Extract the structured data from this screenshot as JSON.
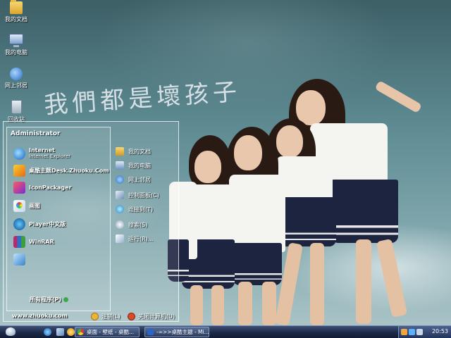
{
  "desktop": {
    "wallpaper_text": "我們都是壞孩子",
    "icons": [
      {
        "label": "我的文档",
        "icon": "folder-icon"
      },
      {
        "label": "我的电脑",
        "icon": "computer-icon"
      },
      {
        "label": "网上邻居",
        "icon": "network-icon"
      },
      {
        "label": "回收站",
        "icon": "recycle-bin-icon"
      }
    ]
  },
  "start_menu": {
    "user_name": "Administrator",
    "left_items": [
      {
        "title": "Internet",
        "subtitle": "Internet Explorer",
        "icon": "ie-icon"
      },
      {
        "title": "桌酷主题Desk.Zhuoku.Com",
        "subtitle": "",
        "icon": "zhuoku-icon"
      },
      {
        "title": "IconPackager",
        "subtitle": "",
        "icon": "iconpackager-icon"
      },
      {
        "title": "画图",
        "subtitle": "",
        "icon": "paint-icon"
      },
      {
        "title": "Player中文版",
        "subtitle": "",
        "icon": "player-icon"
      },
      {
        "title": "WinRAR",
        "subtitle": "",
        "icon": "winrar-icon"
      },
      {
        "title": "",
        "subtitle": "",
        "icon": "program-icon"
      }
    ],
    "all_programs": "所有程序(P)",
    "right_items": [
      {
        "label": "我的文档",
        "icon": "folder-icon"
      },
      {
        "label": "我的电脑",
        "icon": "computer-icon"
      },
      {
        "label": "网上邻居",
        "icon": "network-icon"
      },
      {
        "label": "控制面板(C)",
        "icon": "control-panel-icon"
      },
      {
        "label": "连接到(T)",
        "icon": "connect-icon"
      },
      {
        "label": "搜索(S)",
        "icon": "search-icon"
      },
      {
        "label": "运行(R)...",
        "icon": "run-icon"
      }
    ],
    "footer_url": "www.zhuoku.com",
    "logoff": "注销(L)",
    "shutdown": "关闭计算机(U)"
  },
  "taskbar": {
    "tasks": [
      {
        "label": "桌面 - 壁纸 - 桌酷...",
        "icon": "chrome-icon"
      },
      {
        "label": "-=>>桌酷主题 - Mi...",
        "icon": "document-icon"
      }
    ],
    "clock": "20:53"
  }
}
